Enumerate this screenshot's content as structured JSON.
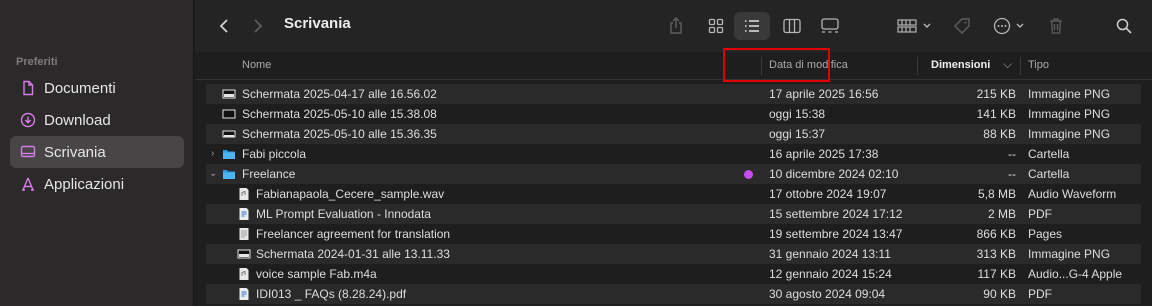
{
  "sidebar": {
    "section": "Preferiti",
    "items": [
      {
        "label": "Documenti",
        "icon": "document-icon"
      },
      {
        "label": "Download",
        "icon": "download-icon"
      },
      {
        "label": "Scrivania",
        "icon": "desktop-icon",
        "active": true
      },
      {
        "label": "Applicazioni",
        "icon": "applications-icon"
      }
    ]
  },
  "toolbar": {
    "title": "Scrivania",
    "icons": [
      "back-icon",
      "forward-icon",
      "share-icon",
      "grid-view-icon",
      "list-view-icon",
      "column-view-icon",
      "gallery-view-icon",
      "group-icon",
      "tag-icon",
      "more-icon",
      "trash-icon",
      "search-icon"
    ]
  },
  "columns": {
    "name": "Nome",
    "date": "Data di modifica",
    "size": "Dimensioni",
    "type": "Tipo"
  },
  "files": [
    {
      "name": "Schermata 2025-04-17 alle 16.56.02",
      "date": "17 aprile 2025 16:56",
      "size": "215 KB",
      "type": "Immagine PNG",
      "icon": "screenshot-icon"
    },
    {
      "name": "Schermata 2025-05-10 alle 15.38.08",
      "date": "oggi 15:38",
      "size": "141 KB",
      "type": "Immagine PNG",
      "icon": "screenshot-icon"
    },
    {
      "name": "Schermata 2025-05-10 alle 15.36.35",
      "date": "oggi 15:37",
      "size": "88 KB",
      "type": "Immagine PNG",
      "icon": "screenshot-icon"
    },
    {
      "name": "Fabi piccola",
      "date": "16 aprile 2025 17:38",
      "size": "--",
      "type": "Cartella",
      "icon": "folder-icon"
    },
    {
      "name": "Freelance",
      "date": "10 dicembre 2024 02:10",
      "size": "--",
      "type": "Cartella",
      "icon": "folder-icon",
      "tag_color": "#c94cf0"
    },
    {
      "name": "Fabianapaola_Cecere_sample.wav",
      "date": "17 ottobre 2024 19:07",
      "size": "5,8 MB",
      "type": "Audio Waveform",
      "icon": "audio-file-icon"
    },
    {
      "name": "ML Prompt Evaluation - Innodata",
      "date": "15 settembre 2024 17:12",
      "size": "2 MB",
      "type": "PDF",
      "icon": "pdf-file-icon"
    },
    {
      "name": "Freelancer agreement for translation",
      "date": "19 settembre 2024 13:47",
      "size": "866 KB",
      "type": "Pages",
      "icon": "pages-file-icon"
    },
    {
      "name": "Schermata 2024-01-31 alle 13.11.33",
      "date": "31 gennaio 2024 13:11",
      "size": "313 KB",
      "type": "Immagine PNG",
      "icon": "screenshot-icon"
    },
    {
      "name": "voice sample Fab.m4a",
      "date": "12 gennaio 2024 15:24",
      "size": "117 KB",
      "type": "Audio...G-4 Apple",
      "icon": "audio-file-icon"
    },
    {
      "name": "IDI013 _ FAQs (8.28.24).pdf",
      "date": "30 agosto 2024 09:04",
      "size": "90 KB",
      "type": "PDF",
      "icon": "pdf-file-icon"
    }
  ]
}
